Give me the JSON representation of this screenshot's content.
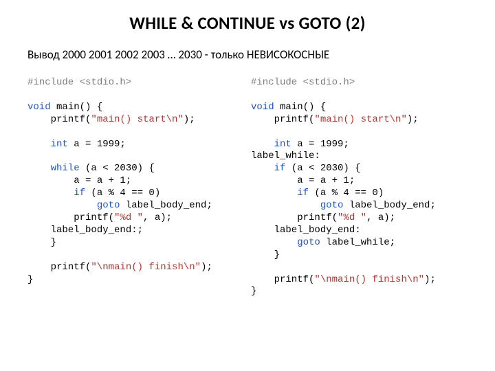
{
  "title": "WHILE & CONTINUE vs GOTO (2)",
  "subtitle": "Вывод  2000 2001 2002 2003 … 2030 - только НЕВИСОКОСНЫЕ",
  "left": {
    "l1": "#include <stdio.h>",
    "l2": "void",
    "l3": " main() {",
    "l4": "    printf(",
    "l5": "\"main() start\\n\"",
    "l6": ");",
    "l7": "    int",
    "l8": " a = 1999;",
    "l9": "    while",
    "l10": " (a < 2030) {",
    "l11": "        a = a + 1;",
    "l12": "        if",
    "l13": " (a % 4 == 0)",
    "l14": "            goto",
    "l15": " label_body_end;",
    "l16": "        printf(",
    "l17": "\"%d \"",
    "l18": ", a);",
    "l19": "    label_body_end:;",
    "l20": "    }",
    "l21": "    printf(",
    "l22": "\"\\nmain() finish\\n\"",
    "l23": ");",
    "l24": "}"
  },
  "right": {
    "l1": "#include <stdio.h>",
    "l2": "void",
    "l3": " main() {",
    "l4": "    printf(",
    "l5": "\"main() start\\n\"",
    "l6": ");",
    "l7": "    int",
    "l8": " a = 1999;",
    "l9": "label_while:",
    "l10": "    if",
    "l11": " (a < 2030) {",
    "l12": "        a = a + 1;",
    "l13": "        if",
    "l14": " (a % 4 == 0)",
    "l15": "            goto",
    "l16": " label_body_end;",
    "l17": "        printf(",
    "l18": "\"%d \"",
    "l19": ", a);",
    "l20": "    label_body_end:",
    "l21": "        goto",
    "l22": " label_while;",
    "l23": "    }",
    "l24": "    printf(",
    "l25": "\"\\nmain() finish\\n\"",
    "l26": ");",
    "l27": "}"
  }
}
